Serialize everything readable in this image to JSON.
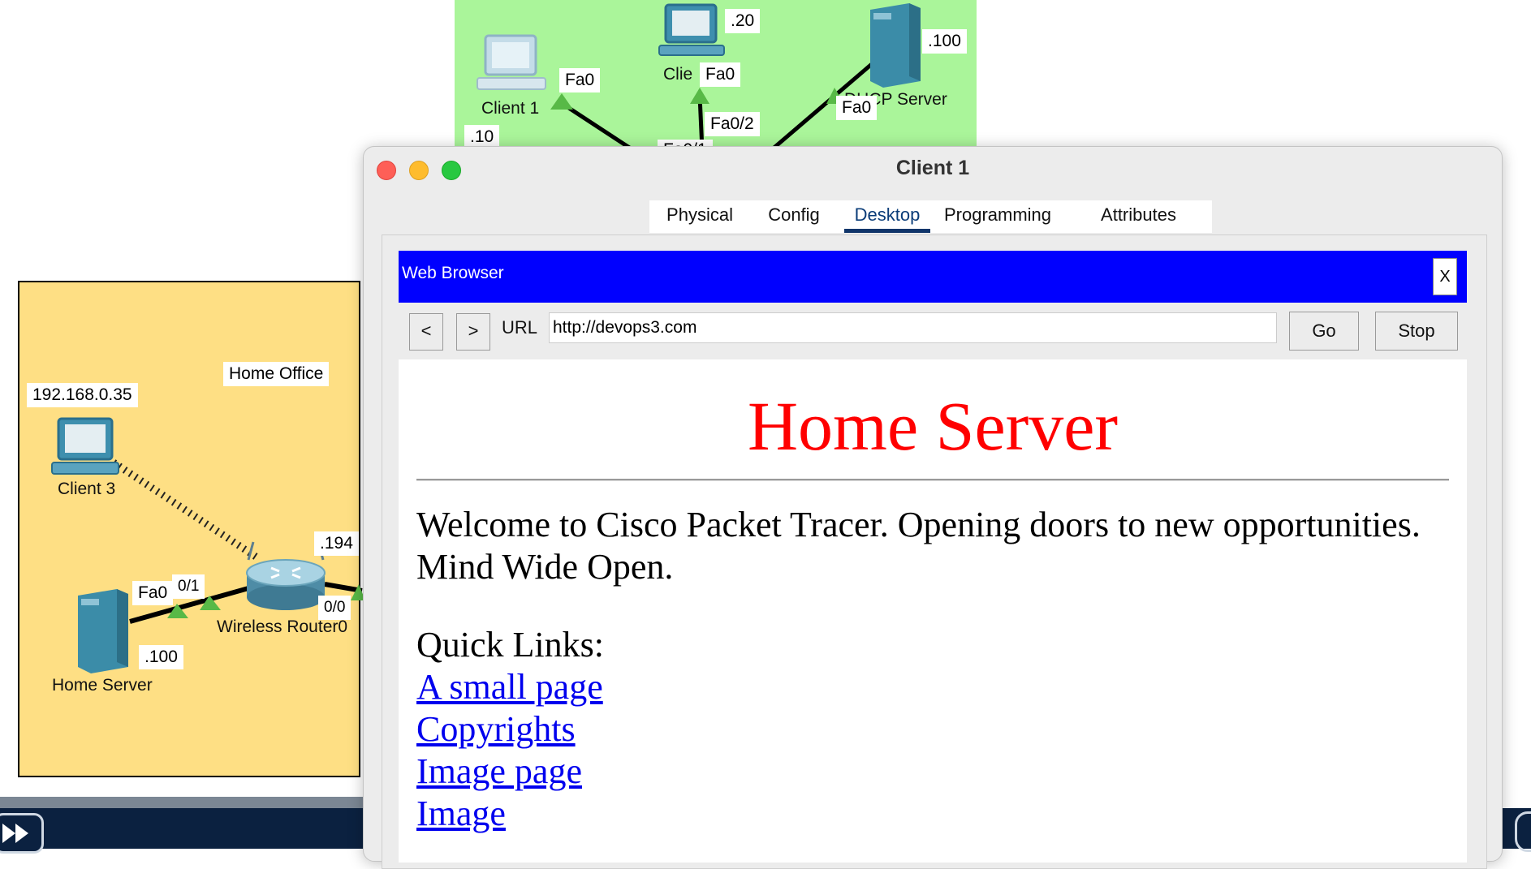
{
  "topology": {
    "green_area": {
      "client1_label": "Client 1",
      "client1_addr": ".10",
      "client1_port": "Fa0",
      "client2_label": "Clie",
      "client2_addr": ".20",
      "client2_port": "Fa0",
      "switch_port": "Fa0/2",
      "switch_port_partial": "Fa0/1",
      "dhcp_server_label": "DHCP Server",
      "dhcp_server_addr": ".100",
      "dhcp_server_port": "Fa0"
    },
    "home_office": {
      "area_label": "Home Office",
      "client3_ip": "192.168.0.35",
      "client3_label": "Client 3",
      "router_label": "Wireless Router0",
      "router_addr": ".194",
      "router_port_left": "0/1",
      "router_port_right": "0/0",
      "server_port": "Fa0",
      "server_label": "Home Server",
      "server_addr": ".100"
    }
  },
  "window": {
    "title": "Client 1",
    "tabs": [
      {
        "label": "Physical"
      },
      {
        "label": "Config"
      },
      {
        "label": "Desktop",
        "active": true
      },
      {
        "label": "Programming"
      },
      {
        "label": "Attributes"
      }
    ]
  },
  "browser": {
    "title": "Web Browser",
    "close_label": "X",
    "back_label": "<",
    "forward_label": ">",
    "url_label": "URL",
    "url_value": "http://devops3.com",
    "go_label": "Go",
    "stop_label": "Stop",
    "page": {
      "heading": "Home Server",
      "welcome": "Welcome to Cisco Packet Tracer. Opening doors to new opportunities. Mind Wide Open.",
      "quick_links_label": "Quick Links:",
      "links": [
        {
          "text": "A small page"
        },
        {
          "text": "Copyrights"
        },
        {
          "text": "Image page"
        },
        {
          "text": "Image"
        }
      ]
    }
  },
  "colors": {
    "green_area": "#aaf59a",
    "yellow_area": "#fedf84",
    "browser_header": "#0000ff",
    "page_heading": "#ff0000",
    "link": "#0000ee",
    "bottom_bar": "#0b2140"
  },
  "icons": [
    "pc-icon",
    "server-icon",
    "router-icon",
    "link-light-icon",
    "fast-forward-icon"
  ]
}
